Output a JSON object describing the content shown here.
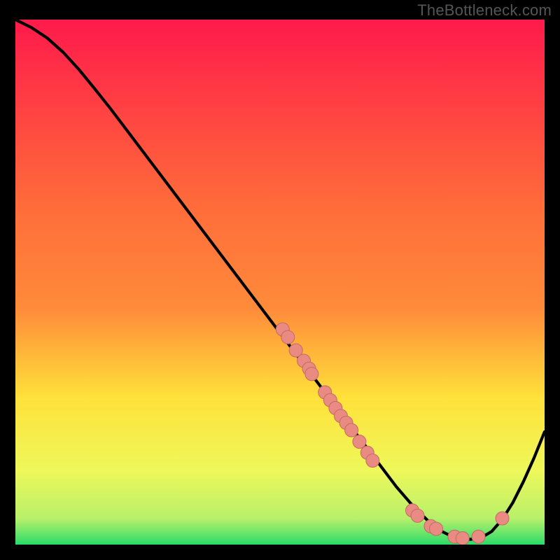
{
  "watermark": "TheBottleneck.com",
  "colors": {
    "dot": "#e98a83",
    "dot_stroke": "#c46a63",
    "curve": "#000000",
    "frame": "#000000",
    "gradient_top": "#ff1a4b",
    "gradient_mid1": "#ff8b3a",
    "gradient_mid2": "#ffe13a",
    "gradient_mid3": "#eef85a",
    "gradient_bottom": "#2bdc6a"
  },
  "chart_data": {
    "type": "line",
    "title": "",
    "xlabel": "",
    "ylabel": "",
    "xlim": [
      0,
      100
    ],
    "ylim": [
      0,
      100
    ],
    "curve": {
      "x": [
        0,
        3,
        6,
        9,
        12,
        15,
        18,
        21,
        24,
        27,
        30,
        33,
        36,
        39,
        42,
        45,
        48,
        51,
        54,
        57,
        60,
        63,
        66,
        69,
        72,
        75,
        78,
        80,
        82,
        84,
        86,
        88,
        90,
        92,
        94,
        96,
        98,
        100
      ],
      "y": [
        100,
        98.5,
        96.5,
        93.8,
        90.5,
        86.8,
        83.0,
        79.0,
        75.0,
        71.0,
        67.0,
        63.0,
        59.0,
        55.0,
        51.0,
        47.0,
        43.0,
        39.0,
        35.0,
        31.0,
        27.0,
        23.0,
        19.0,
        15.0,
        11.0,
        7.5,
        4.5,
        2.8,
        1.8,
        1.2,
        1.0,
        1.3,
        2.5,
        4.8,
        8.0,
        12.0,
        16.5,
        21.5
      ]
    },
    "scatter_clusters": [
      {
        "x": 50.5,
        "y": 41.0
      },
      {
        "x": 51.5,
        "y": 39.5
      },
      {
        "x": 53.0,
        "y": 37.0
      },
      {
        "x": 54.5,
        "y": 35.0
      },
      {
        "x": 55.5,
        "y": 33.5
      },
      {
        "x": 56.0,
        "y": 32.5
      },
      {
        "x": 58.5,
        "y": 29.0
      },
      {
        "x": 59.5,
        "y": 27.5
      },
      {
        "x": 60.5,
        "y": 26.0
      },
      {
        "x": 61.5,
        "y": 24.5
      },
      {
        "x": 62.5,
        "y": 23.2
      },
      {
        "x": 63.5,
        "y": 21.8
      },
      {
        "x": 65.0,
        "y": 19.6
      },
      {
        "x": 66.5,
        "y": 17.5
      },
      {
        "x": 67.5,
        "y": 16.0
      },
      {
        "x": 75.0,
        "y": 6.5
      },
      {
        "x": 76.0,
        "y": 5.5
      },
      {
        "x": 78.5,
        "y": 3.5
      },
      {
        "x": 79.5,
        "y": 3.0
      },
      {
        "x": 83.0,
        "y": 1.5
      },
      {
        "x": 84.5,
        "y": 1.2
      },
      {
        "x": 87.5,
        "y": 1.5
      },
      {
        "x": 92.0,
        "y": 5.0
      }
    ]
  }
}
